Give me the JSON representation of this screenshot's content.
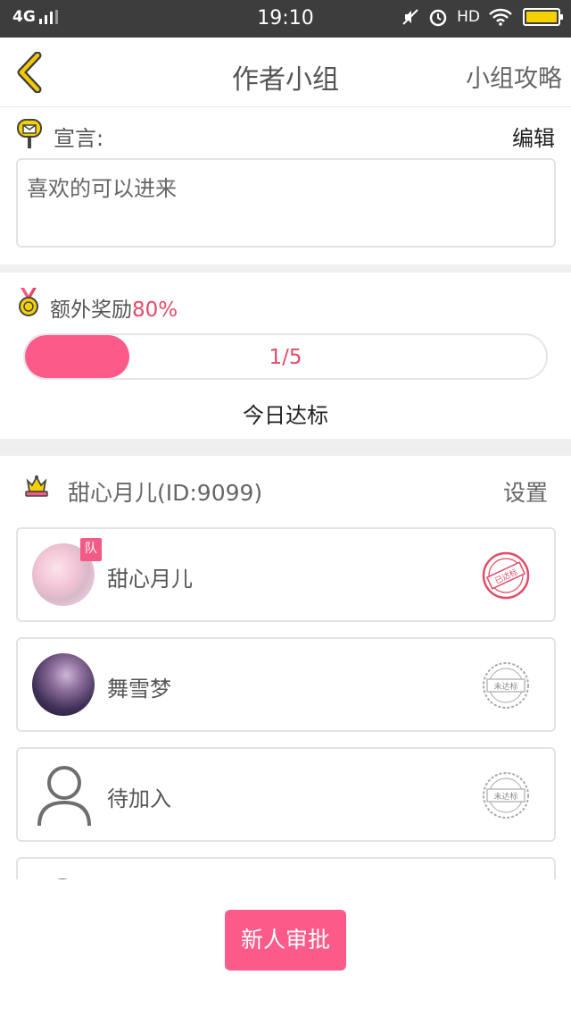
{
  "status_bar": {
    "network": "4G",
    "time": "19:10",
    "hd": "HD",
    "battery_color": "#f7d000",
    "icons": [
      "signal-icon",
      "mute-icon",
      "alarm-icon",
      "wifi-icon",
      "battery-icon"
    ]
  },
  "nav": {
    "title": "作者小组",
    "right_link": "小组攻略",
    "back_icon": "chevron-left-icon",
    "accent": "#f5c800"
  },
  "declaration": {
    "label": "宣言:",
    "edit": "编辑",
    "text": "喜欢的可以进来",
    "icon": "mailbox-icon"
  },
  "reward": {
    "label": "额外奖励",
    "percent": "80%",
    "progress_text": "1/5",
    "progress_fraction": 0.2,
    "today_label": "今日达标",
    "icon": "medal-icon",
    "accent": "#fc5b8a"
  },
  "team": {
    "name": "甜心月儿(ID:9099)",
    "settings": "设置",
    "icon": "crown-icon"
  },
  "members": [
    {
      "name": "甜心月儿",
      "tag": "队",
      "status": "已达标",
      "status_color": "#e34b67",
      "avatar": "avatar-photo"
    },
    {
      "name": "舞雪梦",
      "status": "未达标",
      "status_color": "#999999",
      "avatar": "avatar-photo"
    },
    {
      "name": "待加入",
      "status": "未达标",
      "status_color": "#999999",
      "avatar": "person-placeholder-icon"
    }
  ],
  "footer": {
    "approve_button": "新人审批",
    "button_color": "#fc5b8a"
  }
}
